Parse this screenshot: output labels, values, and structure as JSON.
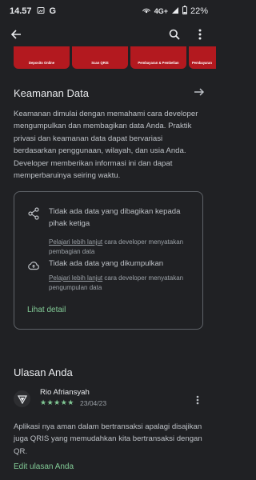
{
  "status_bar": {
    "time": "14.57",
    "network": "4G+",
    "battery": "22%",
    "icons": [
      "google-g-icon",
      "hotspot-icon",
      "signal-icon",
      "battery-icon"
    ]
  },
  "app_bar": {
    "icons": [
      "back-arrow-icon",
      "search-icon",
      "more-vert-icon"
    ]
  },
  "screenshots": [
    {
      "label": "Deposito Online"
    },
    {
      "label": "Scan QRIS"
    },
    {
      "label": "Pembayaran & Pembelian"
    },
    {
      "label": "Pembayaran"
    }
  ],
  "data_safety": {
    "title": "Keamanan Data",
    "description": "Keamanan dimulai dengan memahami cara developer mengumpulkan dan membagikan data Anda. Praktik privasi dan keamanan data dapat bervariasi berdasarkan penggunaan, wilayah, dan usia Anda. Developer memberikan informasi ini dan dapat memperbaruinya seiring waktu.",
    "items": [
      {
        "icon": "share-icon",
        "title": "Tidak ada data yang dibagikan kepada pihak ketiga",
        "link": "Pelajari lebih lanjut",
        "sub": " cara developer menyatakan pembagian data"
      },
      {
        "icon": "cloud-upload-icon",
        "title": "Tidak ada data yang dikumpulkan",
        "link": "Pelajari lebih lanjut",
        "sub": " cara developer menyatakan pengumpulan data"
      }
    ],
    "see_details": "Lihat detail"
  },
  "your_review": {
    "title": "Ulasan Anda",
    "reviewer": "Rio Afriansyah",
    "rating": 5,
    "stars": "★★★★★",
    "date": "23/04/23",
    "text": "Aplikasi nya aman dalam bertransaksi apalagi disajikan juga QRIS yang memudahkan kita bertransaksi dengan QR.",
    "edit": "Edit ulasan Anda"
  },
  "colors": {
    "background": "#202124",
    "accent": "#81c995",
    "screenshot_red": "#b3191f"
  }
}
